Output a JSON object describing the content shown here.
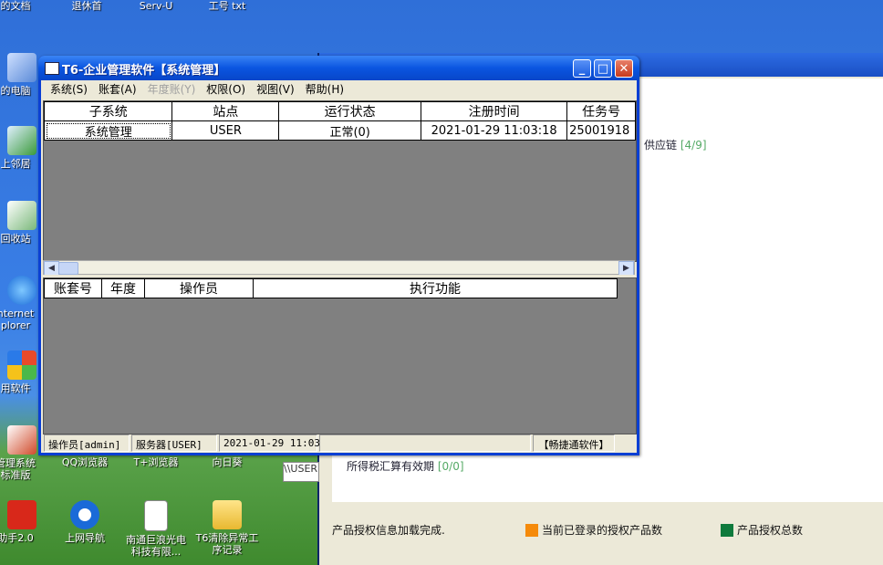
{
  "desktop": {
    "icons": [
      {
        "label": "的文档",
        "label2": ""
      },
      {
        "label": "退休首",
        "label2": ""
      },
      {
        "label": "Serv-U",
        "label2": ""
      },
      {
        "label": "工号 txt",
        "label2": ""
      },
      {
        "label": "的电脑",
        "label2": ""
      },
      {
        "label": "上邻居",
        "label2": ""
      },
      {
        "label": "回收站",
        "label2": ""
      },
      {
        "label": "nternet",
        "label2": "plorer"
      },
      {
        "label": "用软件",
        "label2": ""
      },
      {
        "label": "管理系统",
        "label2": "标准版"
      },
      {
        "label": "QQ浏览器",
        "label2": ""
      },
      {
        "label": "T+浏览器",
        "label2": ""
      },
      {
        "label": "向日葵",
        "label2": ""
      },
      {
        "label": "助手2.0",
        "label2": ""
      },
      {
        "label": "上网导航",
        "label2": ""
      },
      {
        "label": "南通巨浪光电",
        "label2": "科技有限..."
      },
      {
        "label": "T6清除异常工",
        "label2": "序记录"
      }
    ]
  },
  "background_window": {
    "supply_text": "供应链",
    "supply_count": "[4/9]",
    "tax_text": "所得税汇算有效期",
    "tax_count": "[0/0]",
    "unc_text": "\\\\USER",
    "status_text": "产品授权信息加载完成.",
    "legend_logged": "当前已登录的授权产品数",
    "legend_total": "产品授权总数",
    "colors": {
      "logged": "#f58a0a",
      "total": "#0f7a3c"
    }
  },
  "window": {
    "title": "T6-企业管理软件【系统管理】",
    "menu": [
      {
        "label": "系统(S)",
        "enabled": true
      },
      {
        "label": "账套(A)",
        "enabled": true
      },
      {
        "label": "年度账(Y)",
        "enabled": false
      },
      {
        "label": "权限(O)",
        "enabled": true
      },
      {
        "label": "视图(V)",
        "enabled": true
      },
      {
        "label": "帮助(H)",
        "enabled": true
      }
    ],
    "grid1": {
      "columns": [
        "子系统",
        "站点",
        "运行状态",
        "注册时间",
        "任务号"
      ],
      "rows": [
        [
          "系统管理",
          "USER",
          "正常(0)",
          "2021-01-29 11:03:18",
          "25001918"
        ]
      ]
    },
    "grid2": {
      "columns": [
        "账套号",
        "年度",
        "操作员",
        "执行功能"
      ]
    },
    "statusbar": {
      "operator": "操作员[admin]",
      "server": "服务器[USER]",
      "datetime": "2021-01-29 11:03",
      "brand": "【畅捷通软件】"
    }
  }
}
